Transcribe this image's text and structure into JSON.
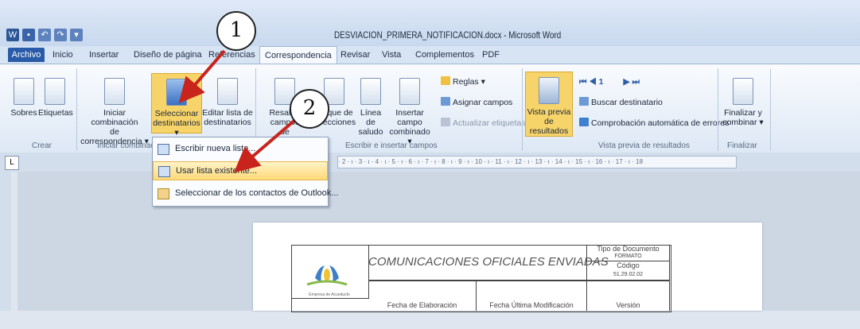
{
  "window": {
    "title": "DESVIACION_PRIMERA_NOTIFICACION.docx - Microsoft Word"
  },
  "tabs": [
    "Archivo",
    "Inicio",
    "Insertar",
    "Diseño de página",
    "Referencias",
    "Correspondencia",
    "Revisar",
    "Vista",
    "Complementos",
    "PDF"
  ],
  "ribbon": {
    "groups": {
      "crear": "Crear",
      "iniciar": "Iniciar combinac",
      "escribir": "Escribir e insertar campos",
      "vista_previa": "Vista previa de resultados",
      "finalizar": "Finalizar"
    },
    "buttons": {
      "sobres": "Sobres",
      "etiquetas": "Etiquetas",
      "iniciar_1": "Iniciar combinación",
      "iniciar_2": "de correspondencia ▾",
      "seleccionar_1": "Seleccionar",
      "seleccionar_2": "destinatarios ▾",
      "editar_1": "Editar lista de",
      "editar_2": "destinatarios",
      "resaltar_1": "Resaltar campos",
      "resaltar_2": "de combinación",
      "bloque_1": "Bloque de",
      "bloque_2": "direcciones",
      "linea_1": "Línea de",
      "linea_2": "saludo",
      "insertar_1": "Insertar campo",
      "insertar_2": "combinado ▾",
      "reglas": "Reglas ▾",
      "asignar": "Asignar campos",
      "actualizar": "Actualizar etiquetas",
      "vista_1": "Vista previa",
      "vista_2": "de resultados",
      "nav_page": "1",
      "buscar": "Buscar destinatario",
      "comprobacion": "Comprobación automática de errores",
      "finalizar_1": "Finalizar y",
      "finalizar_2": "combinar ▾"
    }
  },
  "menu": {
    "items": [
      "Escribir nueva lista...",
      "Usar lista existente...",
      "Seleccionar de los contactos de Outlook..."
    ]
  },
  "ruler": {
    "text": "· 2 · ı · 3 · ı · 4 · ı · 5 · ı · 6 · ı · 7 · ı · 8 · ı · 9 · ı · 10 · ı · 11 · ı · 12 · ı · 13 · ı · 14 · ı · 15 · ı · 16 · ı · 17 · ı · 18",
    "tab_stop": "L"
  },
  "document": {
    "header_title": "COMUNICACIONES OFICIALES ENVIADAS",
    "tipo_documento": "Tipo de Documento",
    "formato": "FORMATO",
    "codigo": "Código",
    "codigo_valor": "51.29.02.02",
    "fecha_elaboracion": "Fecha de Elaboración",
    "fecha_modificacion": "Fecha Última Modificación",
    "version": "Versión",
    "logo_text": "Empresa de Acueducto"
  },
  "annotations": {
    "step1": "1",
    "step2": "2"
  },
  "colors": {
    "archivo_tab": "#2a5ba8",
    "highlight": "#f7d46a",
    "arrow": "#c8241c"
  }
}
